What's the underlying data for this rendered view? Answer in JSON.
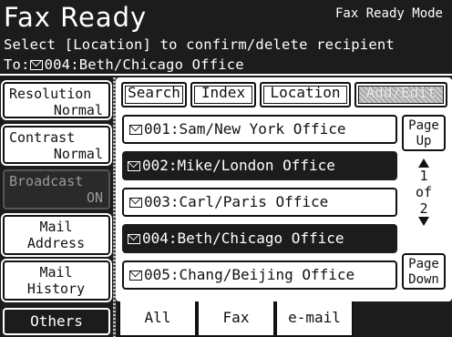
{
  "header": {
    "title": "Fax Ready",
    "mode": "Fax Ready Mode",
    "instruction": "Select [Location] to confirm/delete recipient",
    "to_prefix": "To:",
    "to_value": "004:Beth/Chicago Office"
  },
  "left_menu": [
    {
      "line1": "Resolution",
      "line2": "Normal"
    },
    {
      "line1": "Contrast",
      "line2": "Normal"
    },
    {
      "line1": "Broadcast",
      "line2": "ON"
    },
    {
      "line1": "Mail",
      "line2": "Address"
    },
    {
      "line1": "Mail",
      "line2": "History"
    }
  ],
  "others_label": "Others",
  "top_tabs": [
    "Search",
    "Index",
    "Location",
    "Add/Edit"
  ],
  "recipients": [
    "001:Sam/New York Office",
    "002:Mike/London Office",
    "003:Carl/Paris Office",
    "004:Beth/Chicago Office",
    "005:Chang/Beijing Office"
  ],
  "paging": {
    "up_line1": "Page",
    "up_line2": "Up",
    "current": "1",
    "of": "of",
    "total": "2",
    "down_line1": "Page",
    "down_line2": "Down"
  },
  "bottom_tabs": [
    "All",
    "Fax",
    "e-mail"
  ]
}
